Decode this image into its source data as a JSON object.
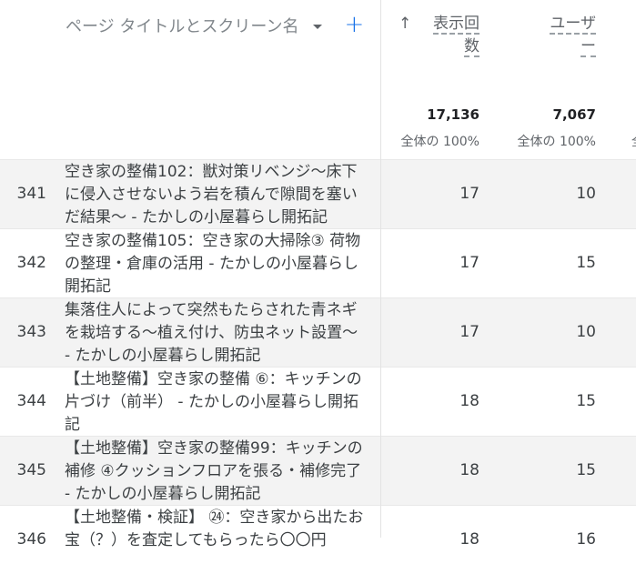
{
  "header": {
    "dimension_label": "ページ タイトルとスクリーン名",
    "add_label": "+",
    "sort_arrow": "↑",
    "metric_views_line1": "表示回",
    "metric_views_line2": "数",
    "metric_users_line1": "ユーザ",
    "metric_users_line2": "ー"
  },
  "totals": {
    "views": "17,136",
    "views_pct": "全体の 100%",
    "users": "7,067",
    "users_pct": "全体の 100%",
    "next_cut": "全"
  },
  "rows": [
    {
      "num": "341",
      "title": "空き家の整備102：獣対策リベンジ〜床下に侵入させないよう岩を積んで隙間を塞いだ結果〜 - たかしの小屋暮らし開拓記",
      "views": "17",
      "users": "10"
    },
    {
      "num": "342",
      "title": "空き家の整備105：空き家の大掃除③ 荷物の整理・倉庫の活用 - たかしの小屋暮らし開拓記",
      "views": "17",
      "users": "15"
    },
    {
      "num": "343",
      "title": "集落住人によって突然もたらされた青ネギを栽培する〜植え付け、防虫ネット設置〜 - たかしの小屋暮らし開拓記",
      "views": "17",
      "users": "10"
    },
    {
      "num": "344",
      "title": "【土地整備】空き家の整備 ⑥：キッチンの片づけ（前半） - たかしの小屋暮らし開拓記",
      "views": "18",
      "users": "15"
    },
    {
      "num": "345",
      "title": "【土地整備】空き家の整備99：キッチンの補修 ④クッションフロアを張る・補修完了 - たかしの小屋暮らし開拓記",
      "views": "18",
      "users": "15"
    },
    {
      "num": "346",
      "title": "【土地整備・検証】 ㉔：空き家から出たお宝（？）を査定してもらったら〇〇円",
      "views": "18",
      "users": "16"
    }
  ]
}
